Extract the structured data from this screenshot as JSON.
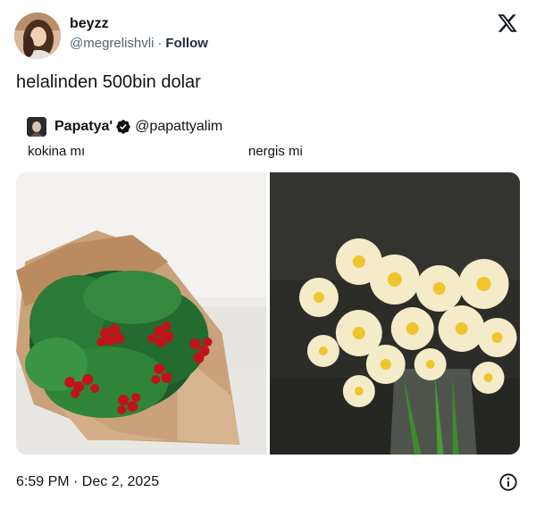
{
  "author": {
    "display_name": "beyzz",
    "handle": "@megrelishvli",
    "separator": "·",
    "follow_label": "Follow",
    "avatar_icon": "user-avatar"
  },
  "brand": {
    "logo_icon": "x-logo-icon"
  },
  "tweet": {
    "text": "helalinden 500bin dolar"
  },
  "quote": {
    "display_name": "Papatya'",
    "verified_icon": "verified-badge-icon",
    "handle": "@papattyalim",
    "captions": [
      "kokina mı",
      "nergis mi"
    ],
    "photos": [
      {
        "description_icon": "kokina-bouquet-photo"
      },
      {
        "description_icon": "daffodil-vase-photo"
      }
    ]
  },
  "footer": {
    "timestamp": "6:59 PM · Dec 2, 2025",
    "info_icon": "info-icon"
  },
  "colors": {
    "text": "#0f1419",
    "secondary": "#536471",
    "follow": "#1d2d40",
    "background": "#ffffff"
  }
}
